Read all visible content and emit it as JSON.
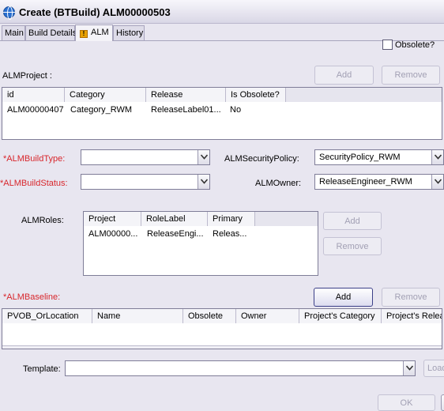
{
  "window": {
    "title": "Create (BTBuild) ALM00000503"
  },
  "tabs": [
    {
      "label": "Main"
    },
    {
      "label": "Build Details"
    },
    {
      "label": "ALM"
    },
    {
      "label": "History"
    }
  ],
  "obsolete_label": "Obsolete?",
  "alm_project": {
    "label": "ALMProject :",
    "add_label": "Add",
    "remove_label": "Remove",
    "columns": [
      "id",
      "Category",
      "Release",
      "Is Obsolete?"
    ],
    "rows": [
      {
        "id": "ALM00000407",
        "category": "Category_RWM",
        "release": "ReleaseLabel01...",
        "obsolete": "No"
      }
    ]
  },
  "build_type": {
    "label": "*ALMBuildType:",
    "value": ""
  },
  "build_status": {
    "label": "*ALMBuildStatus:",
    "value": ""
  },
  "security_policy": {
    "label": "ALMSecurityPolicy:",
    "value": "SecurityPolicy_RWM"
  },
  "owner": {
    "label": "ALMOwner:",
    "value": "ReleaseEngineer_RWM"
  },
  "roles": {
    "label": "ALMRoles:",
    "add_label": "Add",
    "remove_label": "Remove",
    "columns": [
      "Project",
      "RoleLabel",
      "Primary"
    ],
    "rows": [
      {
        "project": "ALM00000...",
        "role": "ReleaseEngi...",
        "primary": "Releas..."
      }
    ]
  },
  "baseline": {
    "label": "*ALMBaseline:",
    "add_label": "Add",
    "remove_label": "Remove",
    "columns": [
      "PVOB_OrLocation",
      "Name",
      "Obsolete",
      "Owner",
      "Project's Category",
      "Project's Relea"
    ]
  },
  "template": {
    "label": "Template:",
    "value": "",
    "load_label": "Load"
  },
  "ok_label": "OK"
}
